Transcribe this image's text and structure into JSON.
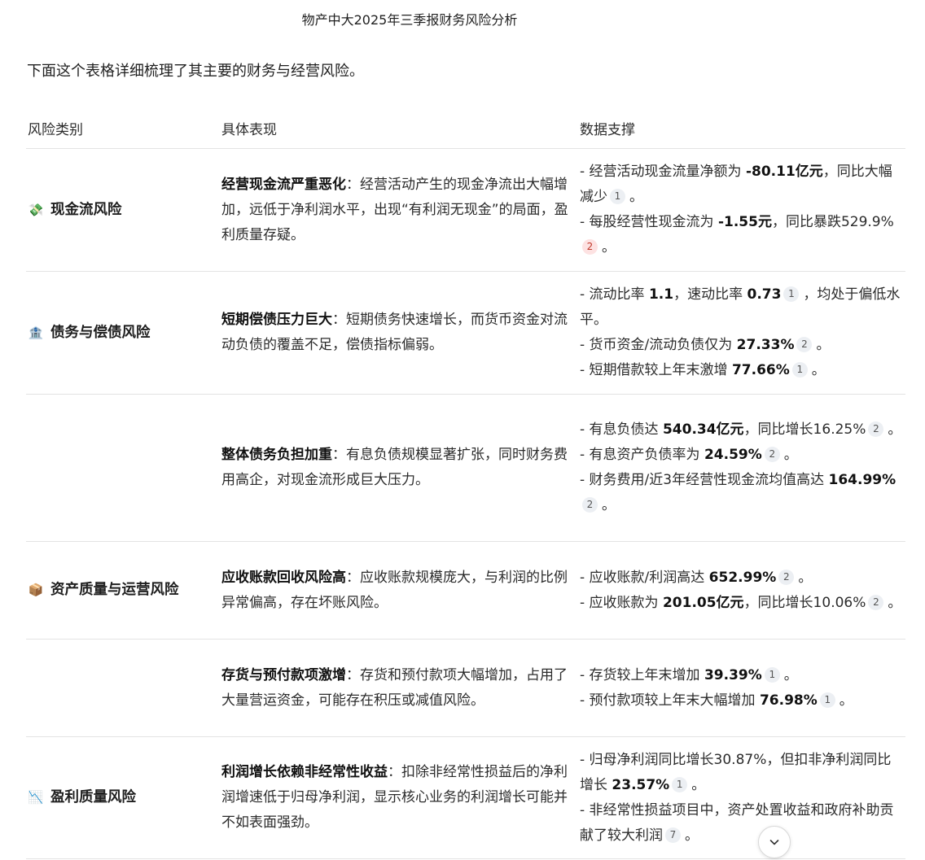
{
  "page": {
    "title": "物产中大2025年三季报财务风险分析",
    "intro": "下面这个表格详细梳理了其主要的财务与经营风险。"
  },
  "table": {
    "headers": [
      "风险类别",
      "具体表现",
      "数据支撑"
    ],
    "rows": [
      {
        "category": "现金流风险",
        "icon": "money-bag-icon",
        "desc_title": "经营现金流严重恶化",
        "desc_text": "：经营活动产生的现金净流出大幅增加，远低于净利润水平，出现“有利润无现金”的局面，盈利质量存疑。",
        "data": [
          [
            {
              "t": "- 经营活动现金流量净额为 "
            },
            {
              "t": "-80.11亿元",
              "b": true
            },
            {
              "t": "，同比大幅减少"
            },
            {
              "c": "1"
            },
            {
              "t": "。"
            }
          ],
          [
            {
              "t": "- 每股经营性现金流为 "
            },
            {
              "t": "-1.55元",
              "b": true
            },
            {
              "t": "，同比暴跌529.9%"
            },
            {
              "c": "2",
              "hot": true
            },
            {
              "t": "。"
            }
          ]
        ]
      },
      {
        "category": "债务与偿债风险",
        "icon": "bank-icon",
        "desc_title": "短期偿债压力巨大",
        "desc_text": "：短期债务快速增长，而货币资金对流动负债的覆盖不足，偿债指标偏弱。",
        "data": [
          [
            {
              "t": "- 流动比率 "
            },
            {
              "t": "1.1",
              "b": true
            },
            {
              "t": "，速动比率 "
            },
            {
              "t": "0.73",
              "b": true
            },
            {
              "c": "1"
            },
            {
              "t": "，均处于偏低水平。"
            }
          ],
          [
            {
              "t": "- 货币资金/流动负债仅为 "
            },
            {
              "t": "27.33%",
              "b": true
            },
            {
              "c": "2"
            },
            {
              "t": "。"
            }
          ],
          [
            {
              "t": "- 短期借款较上年末激增 "
            },
            {
              "t": "77.66%",
              "b": true
            },
            {
              "c": "1"
            },
            {
              "t": "。"
            }
          ]
        ]
      },
      {
        "category": "",
        "icon": "",
        "desc_title": "整体债务负担加重",
        "desc_text": "：有息负债规模显著扩张，同时财务费用高企，对现金流形成巨大压力。",
        "data": [
          [
            {
              "t": "- 有息负债达 "
            },
            {
              "t": "540.34亿元",
              "b": true
            },
            {
              "t": "，同比增长16.25%"
            },
            {
              "c": "2"
            },
            {
              "t": "。"
            }
          ],
          [
            {
              "t": "- 有息资产负债率为 "
            },
            {
              "t": "24.59%",
              "b": true
            },
            {
              "c": "2"
            },
            {
              "t": "。"
            }
          ],
          [
            {
              "t": "- 财务费用/近3年经营性现金流均值高达 "
            },
            {
              "t": "164.99%",
              "b": true
            },
            {
              "c": "2"
            },
            {
              "t": "。"
            }
          ]
        ]
      },
      {
        "category": "资产质量与运营风险",
        "icon": "package-icon",
        "desc_title": "应收账款回收风险高",
        "desc_text": "：应收账款规模庞大，与利润的比例异常偏高，存在坏账风险。",
        "data": [
          [
            {
              "t": "- 应收账款/利润高达 "
            },
            {
              "t": "652.99%",
              "b": true
            },
            {
              "c": "2"
            },
            {
              "t": "。"
            }
          ],
          [
            {
              "t": "- 应收账款为 "
            },
            {
              "t": "201.05亿元",
              "b": true
            },
            {
              "t": "，同比增长10.06%"
            },
            {
              "c": "2"
            },
            {
              "t": "。"
            }
          ]
        ]
      },
      {
        "category": "",
        "icon": "",
        "desc_title": "存货与预付款项激增",
        "desc_text": "：存货和预付款项大幅增加，占用了大量营运资金，可能存在积压或减值风险。",
        "data": [
          [
            {
              "t": "- 存货较上年末增加 "
            },
            {
              "t": "39.39%",
              "b": true
            },
            {
              "c": "1"
            },
            {
              "t": "。"
            }
          ],
          [
            {
              "t": "- 预付款项较上年末大幅增加 "
            },
            {
              "t": "76.98%",
              "b": true
            },
            {
              "c": "1"
            },
            {
              "t": "。"
            }
          ]
        ]
      },
      {
        "category": "盈利质量风险",
        "icon": "chart-decreasing-icon",
        "desc_title": "利润增长依赖非经常性收益",
        "desc_text": "：扣除非经常性损益后的净利润增速低于归母净利润，显示核心业务的利润增长可能并不如表面强劲。",
        "data": [
          [
            {
              "t": "- 归母净利润同比增长30.87%，但扣非净利润同比增长 "
            },
            {
              "t": "23.57%",
              "b": true
            },
            {
              "c": "1"
            },
            {
              "t": "。"
            }
          ],
          [
            {
              "t": "- 非经常性损益项目中，资产处置收益和政府补助贡献了较大利润"
            },
            {
              "c": "7"
            },
            {
              "t": "。"
            }
          ]
        ]
      }
    ]
  },
  "scroll_button": {
    "icon": "chevron-down-icon"
  }
}
